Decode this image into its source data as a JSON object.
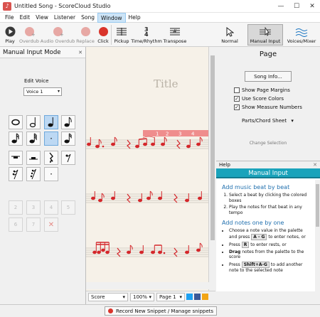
{
  "window": {
    "title": "Untitled Song - ScoreCloud Studio",
    "minimize": "—",
    "maximize": "☐",
    "close": "✕"
  },
  "menu": [
    "File",
    "Edit",
    "View",
    "Listener",
    "Song",
    "Window",
    "Help"
  ],
  "toolbar": {
    "play": "Play",
    "overdub": "Overdub",
    "audio_overdub": "Audio Overdub",
    "replace": "Replace",
    "click": "Click",
    "pickup": "Pickup",
    "time_rhythm": "Time/Rhythm",
    "transpose": "Transpose"
  },
  "view_modes": {
    "normal": "Normal",
    "manual_input": "Manual Input",
    "voices_mixer": "Voices/Mixer"
  },
  "left_panel": {
    "title": "Manual Input Mode",
    "close": "✕",
    "edit_voice_label": "Edit Voice",
    "voice_value": "Voice 1",
    "palette_notes": [
      "𝅝",
      "𝅗𝅥",
      "♩",
      "♪",
      "𝅘𝅥𝅯",
      "𝅘𝅥𝅰",
      "𝅘𝅥𝅱",
      "•"
    ],
    "palette_rests": [
      "▬",
      "▬",
      "𝄽",
      "𝄾",
      "𝄿",
      "𝅀",
      "·"
    ],
    "palette_numbers": [
      "2",
      "3",
      "4",
      "5",
      "6",
      "7",
      "✕"
    ]
  },
  "score": {
    "title": "Title",
    "measure_numbers": [
      "1",
      "2",
      "3",
      "4"
    ]
  },
  "status": {
    "view": "Score",
    "zoom": "100%",
    "page": "Page 1"
  },
  "right_panel": {
    "title": "Page",
    "song_info": "Song Info...",
    "checkboxes": [
      {
        "label": "Show Page Margins",
        "checked": false
      },
      {
        "label": "Use Score Colors",
        "checked": true
      },
      {
        "label": "Show Measure Numbers",
        "checked": true
      }
    ],
    "parts": "Parts/Chord Sheet",
    "change_selection": "Change Selection"
  },
  "help": {
    "header": "Help",
    "banner": "Manual Input",
    "h1": "Add music beat by beat",
    "list1": [
      "Select a beat by clicking the colored boxes",
      "Play the notes for that beat in any tempo"
    ],
    "h2": "Add notes one by one",
    "list2_a": "Choose a note value in the palette and press",
    "list2_a2": "to enter notes, or",
    "key_ag": "A - G",
    "list2_b": "Press",
    "key_r": "R",
    "list2_b2": "to enter rests, or",
    "list2_c_bold": "Drag",
    "list2_c": "notes from the palette to the score",
    "list2_d": "Press",
    "key_shift": "Shift+A-G",
    "list2_d2": "to add another note to the selected note"
  },
  "bottom": {
    "record": "Record New Snippet / Manage snippets"
  },
  "colors": {
    "accent_red": "#d9342b",
    "help_teal": "#1aa3bb",
    "link_blue": "#1f6fae"
  }
}
